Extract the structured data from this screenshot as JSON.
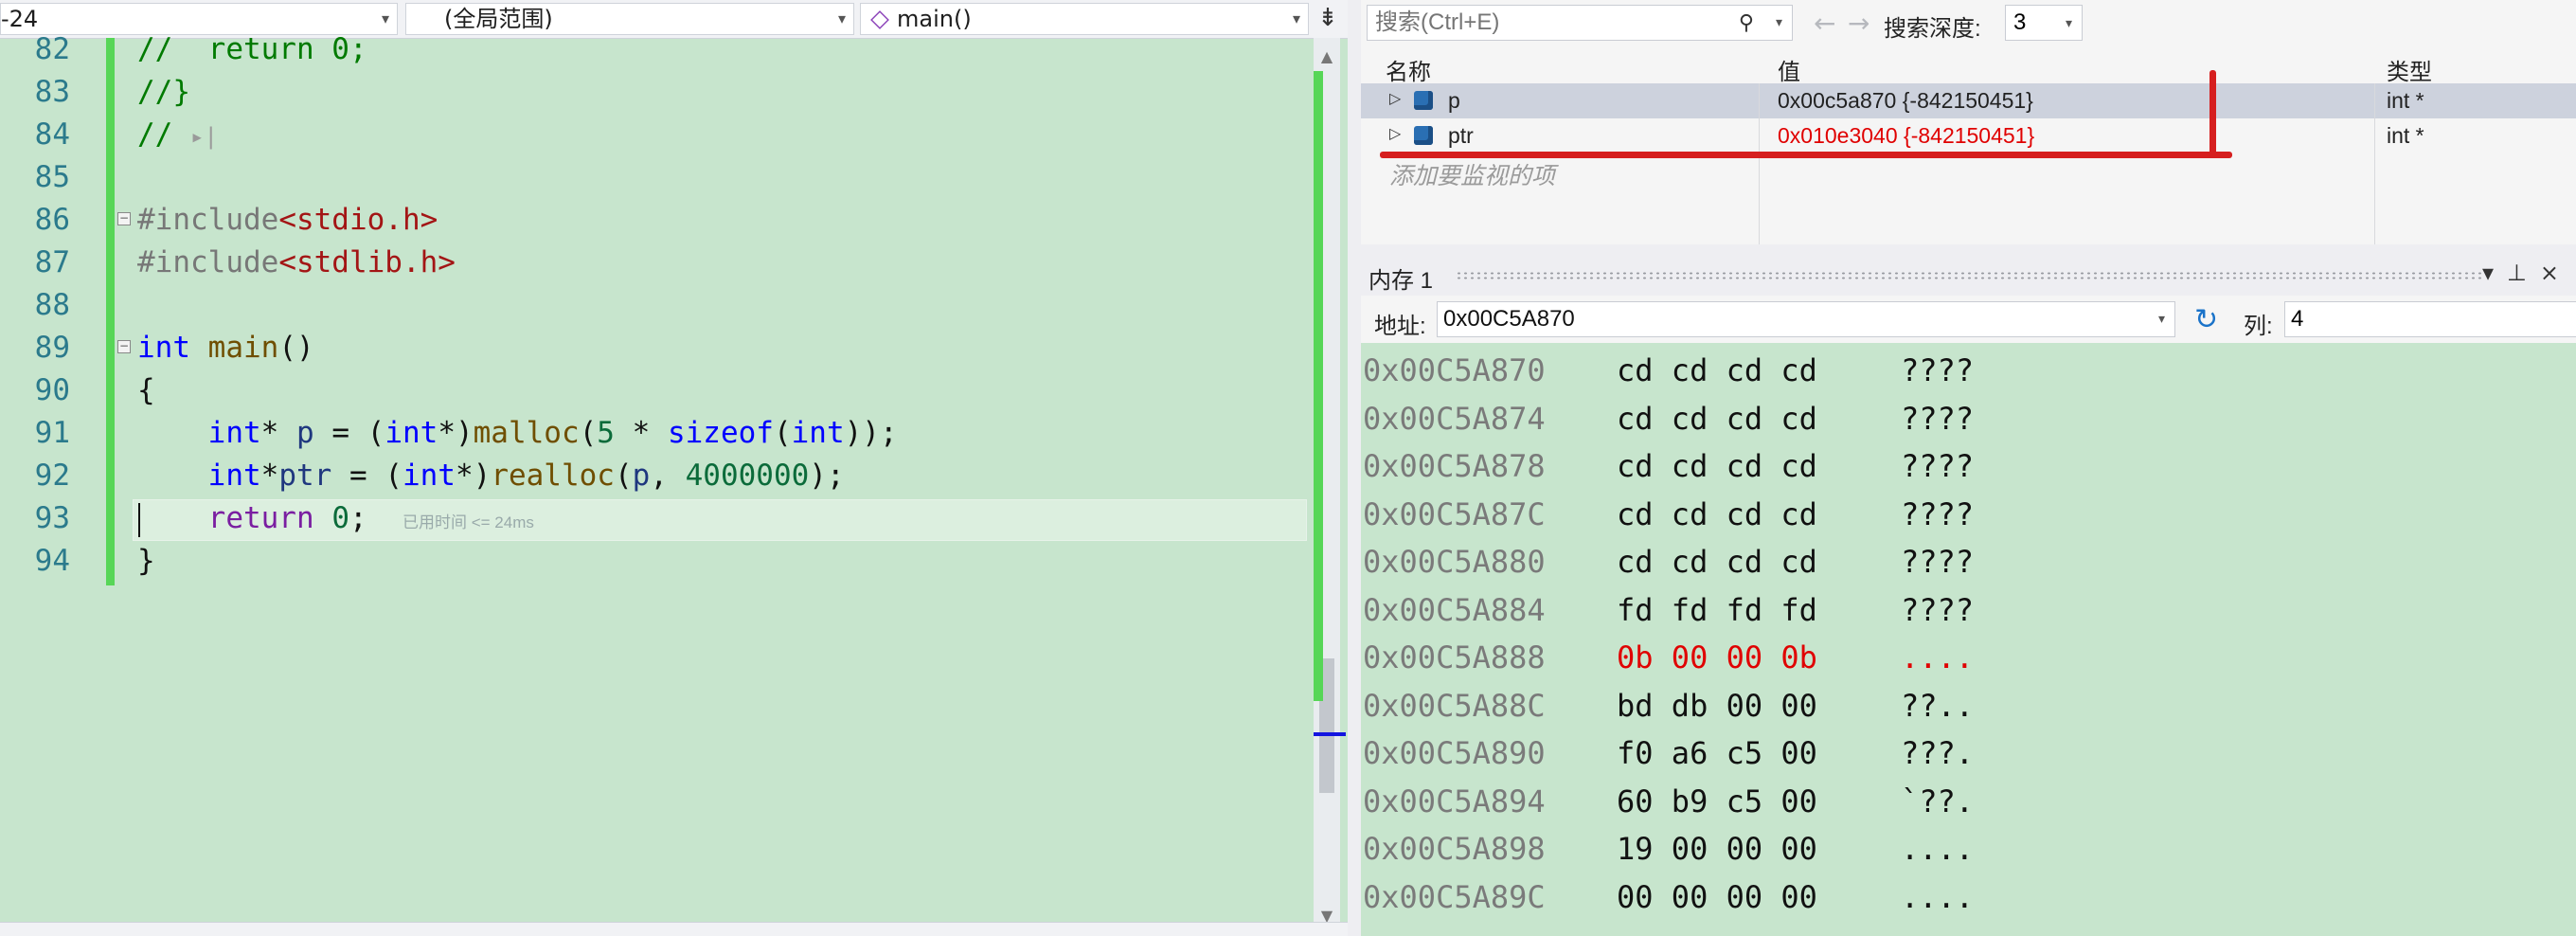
{
  "navbar": {
    "project_combo": "-24",
    "scope_combo": "(全局范围)",
    "function_combo": "main()"
  },
  "editor": {
    "lines": [
      {
        "num": "82",
        "text": "//  return 0;"
      },
      {
        "num": "83",
        "text": "//}"
      },
      {
        "num": "84",
        "text": "//"
      },
      {
        "num": "85",
        "text": ""
      },
      {
        "num": "86",
        "text": "#include<stdio.h>"
      },
      {
        "num": "87",
        "text": "#include<stdlib.h>"
      },
      {
        "num": "88",
        "text": ""
      },
      {
        "num": "89",
        "text": "int main()"
      },
      {
        "num": "90",
        "text": "{"
      },
      {
        "num": "91",
        "text": "    int* p = (int*)malloc(5 * sizeof(int));"
      },
      {
        "num": "92",
        "text": "    int*ptr = (int*)realloc(p, 4000000);"
      },
      {
        "num": "93",
        "text": "    return 0;"
      },
      {
        "num": "94",
        "text": "}"
      }
    ],
    "elapsed_hint": "已用时间 <= 24ms"
  },
  "watch": {
    "search_placeholder": "搜索(Ctrl+E)",
    "depth_label": "搜索深度:",
    "depth_value": "3",
    "columns": {
      "name": "名称",
      "value": "值",
      "type": "类型"
    },
    "rows": [
      {
        "name": "p",
        "value": "0x00c5a870 {-842150451}",
        "type": "int *"
      },
      {
        "name": "ptr",
        "value": "0x010e3040 {-842150451}",
        "type": "int *"
      }
    ],
    "add_watch_placeholder": "添加要监视的项"
  },
  "memory": {
    "title": "内存 1",
    "address_label": "地址:",
    "address_value": "0x00C5A870",
    "columns_label": "列:",
    "columns_value": "4",
    "rows": [
      {
        "addr": "0x00C5A870",
        "bytes": "cd cd cd cd",
        "ascii": "????"
      },
      {
        "addr": "0x00C5A874",
        "bytes": "cd cd cd cd",
        "ascii": "????"
      },
      {
        "addr": "0x00C5A878",
        "bytes": "cd cd cd cd",
        "ascii": "????"
      },
      {
        "addr": "0x00C5A87C",
        "bytes": "cd cd cd cd",
        "ascii": "????"
      },
      {
        "addr": "0x00C5A880",
        "bytes": "cd cd cd cd",
        "ascii": "????"
      },
      {
        "addr": "0x00C5A884",
        "bytes": "fd fd fd fd",
        "ascii": "????"
      },
      {
        "addr": "0x00C5A888",
        "bytes": "0b 00 00 0b",
        "ascii": "...."
      },
      {
        "addr": "0x00C5A88C",
        "bytes": "bd db 00 00",
        "ascii": "??.."
      },
      {
        "addr": "0x00C5A890",
        "bytes": "f0 a6 c5 00",
        "ascii": "???."
      },
      {
        "addr": "0x00C5A894",
        "bytes": "60 b9 c5 00",
        "ascii": "`??."
      },
      {
        "addr": "0x00C5A898",
        "bytes": "19 00 00 00",
        "ascii": "...."
      },
      {
        "addr": "0x00C5A89C",
        "bytes": "00 00 00 00",
        "ascii": "...."
      }
    ]
  },
  "colors": {
    "changed": "#e00000",
    "editor_bg": "#c7e5cd",
    "annotation_red": "#d61f1f"
  }
}
